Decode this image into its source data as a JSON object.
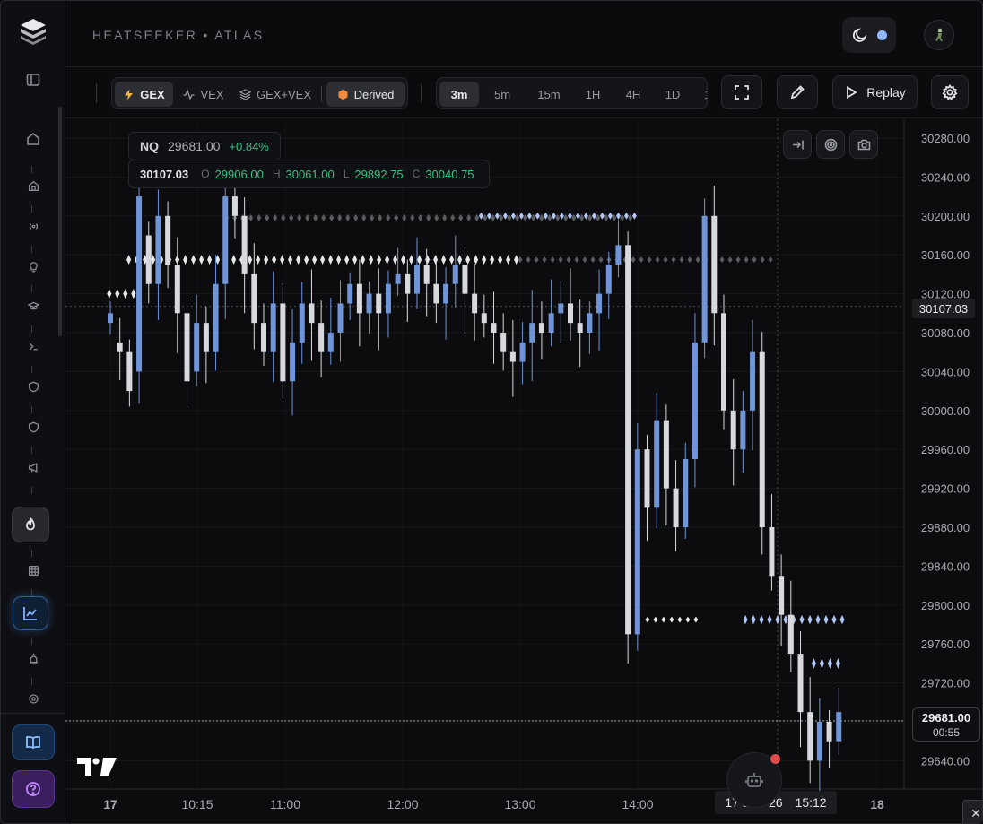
{
  "app": {
    "brand": "HEATSEEKER  •  ATLAS"
  },
  "sidebar": {
    "items": [
      {
        "name": "home",
        "icon": "home-icon"
      },
      {
        "name": "house",
        "icon": "house-icon"
      },
      {
        "name": "signal",
        "icon": "broadcast-icon"
      },
      {
        "name": "ideas",
        "icon": "lightbulb-icon"
      },
      {
        "name": "learn",
        "icon": "graduation-cap-icon"
      },
      {
        "name": "terminal",
        "icon": "terminal-icon"
      },
      {
        "name": "shield-1",
        "icon": "shield-icon"
      },
      {
        "name": "shield-2",
        "icon": "shield-icon"
      },
      {
        "name": "announce",
        "icon": "megaphone-icon"
      },
      {
        "name": "heatseeker",
        "icon": "flame-icon"
      },
      {
        "name": "grid",
        "icon": "grid-icon"
      },
      {
        "name": "chart",
        "icon": "line-chart-icon"
      },
      {
        "name": "alarm",
        "icon": "siren-icon"
      },
      {
        "name": "target",
        "icon": "target-icon"
      },
      {
        "name": "docs",
        "icon": "book-icon"
      },
      {
        "name": "help",
        "icon": "question-icon"
      }
    ]
  },
  "toolbar": {
    "modes": [
      {
        "label": "GEX",
        "active": true
      },
      {
        "label": "VEX",
        "active": false
      },
      {
        "label": "GEX+VEX",
        "active": false
      },
      {
        "label": "Derived",
        "active": false
      }
    ],
    "timeframes": [
      {
        "label": "3m",
        "active": true
      },
      {
        "label": "5m",
        "active": false
      },
      {
        "label": "15m",
        "active": false
      },
      {
        "label": "1H",
        "active": false
      },
      {
        "label": "4H",
        "active": false
      },
      {
        "label": "1D",
        "active": false
      },
      {
        "label": "1",
        "active": false
      }
    ],
    "replay_label": "Replay"
  },
  "legend": {
    "symbol": "NQ",
    "last": "29681.00",
    "change": "+0.84%",
    "crosshair_price": "30107.03",
    "o_label": "O",
    "o": "29906.00",
    "h_label": "H",
    "h": "30061.00",
    "l_label": "L",
    "l": "29892.75",
    "c_label": "C",
    "c": "30040.75"
  },
  "price_axis": {
    "crosshair_tag": "30107.03",
    "last_price_tag": "29681.00",
    "countdown": "00:55"
  },
  "time_axis": {
    "crosshair_date": "17 Jun '26",
    "crosshair_time": "15:12"
  },
  "colors": {
    "bull": "#6f95d8",
    "bear": "#d7d9de",
    "level_white": "#f2f3f5",
    "level_blue": "#b9d0ff",
    "level_gray": "#6d7077",
    "accent_green": "#33c284"
  },
  "chart_data": {
    "type": "candlestick",
    "symbol": "NQ",
    "interval": "3m",
    "ylim": [
      29620,
      30290
    ],
    "y_ticks": [
      "30280.00",
      "30240.00",
      "30200.00",
      "30160.00",
      "30120.00",
      "30080.00",
      "30040.00",
      "30000.00",
      "29960.00",
      "29920.00",
      "29880.00",
      "29840.00",
      "29800.00",
      "29760.00",
      "29720.00",
      "29680.00",
      "29640.00"
    ],
    "x_ticks": [
      "17",
      "10:15",
      "11:00",
      "12:00",
      "13:00",
      "14:00",
      "18"
    ],
    "gex_levels": [
      {
        "price": 30198,
        "from": "10:30",
        "to": "14:00",
        "color": "gray"
      },
      {
        "price": 30200,
        "from": "12:40",
        "to": "14:00",
        "color": "blue"
      },
      {
        "price": 30155,
        "from": "09:40",
        "to": "13:00",
        "color": "white"
      },
      {
        "price": 30155,
        "from": "13:00",
        "to": "15:10",
        "color": "gray"
      },
      {
        "price": 30120,
        "from": "09:30",
        "to": "09:45",
        "color": "white"
      },
      {
        "price": 29785,
        "from": "14:05",
        "to": "14:30",
        "color": "white"
      },
      {
        "price": 29785,
        "from": "14:55",
        "to": "15:45",
        "color": "blue"
      },
      {
        "price": 29740,
        "from": "15:30",
        "to": "15:45",
        "color": "blue"
      }
    ]
  }
}
